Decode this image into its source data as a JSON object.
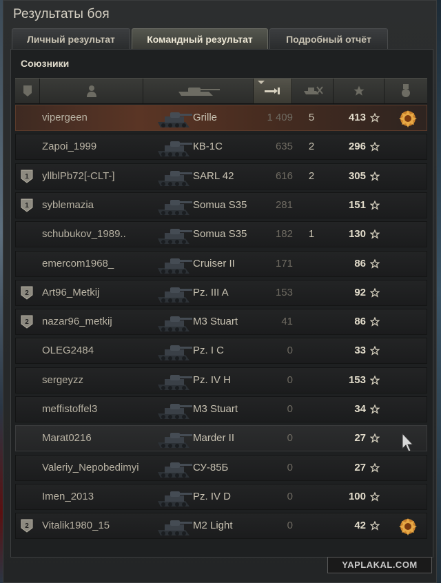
{
  "window": {
    "title": "Результаты боя"
  },
  "tabs": [
    {
      "label": "Личный результат",
      "active": false
    },
    {
      "label": "Командный результат",
      "active": true
    },
    {
      "label": "Подробный отчёт",
      "active": false
    }
  ],
  "section": {
    "title": "Союзники"
  },
  "columns": [
    {
      "icon": "platoon-icon"
    },
    {
      "icon": "player-icon"
    },
    {
      "icon": "tank-icon"
    },
    {
      "icon": "damage-icon",
      "sorted": true
    },
    {
      "icon": "kills-icon"
    },
    {
      "icon": "xp-star-icon"
    },
    {
      "icon": "medal-icon"
    }
  ],
  "rows": [
    {
      "name": "vipergeen",
      "tank": "Grille",
      "damage": "1 409",
      "kills": "5",
      "xp": "413",
      "platoon": "",
      "medal": true,
      "highlight": "me"
    },
    {
      "name": "Zapoi_1999",
      "tank": "КВ-1С",
      "damage": "635",
      "kills": "2",
      "xp": "296",
      "platoon": "",
      "medal": false
    },
    {
      "name": "yllblPb72[-CLT-]",
      "tank": "SARL 42",
      "damage": "616",
      "kills": "2",
      "xp": "305",
      "platoon": "1",
      "medal": false
    },
    {
      "name": "syblemazia",
      "tank": "Somua S35",
      "damage": "281",
      "kills": "",
      "xp": "151",
      "platoon": "1",
      "medal": false
    },
    {
      "name": "schubukov_1989..",
      "tank": "Somua S35",
      "damage": "182",
      "kills": "1",
      "xp": "130",
      "platoon": "",
      "medal": false
    },
    {
      "name": "emercom1968_",
      "tank": "Cruiser II",
      "damage": "171",
      "kills": "",
      "xp": "86",
      "platoon": "",
      "medal": false
    },
    {
      "name": "Art96_Metkij",
      "tank": "Pz. III A",
      "damage": "153",
      "kills": "",
      "xp": "92",
      "platoon": "2",
      "medal": false
    },
    {
      "name": "nazar96_metkij",
      "tank": "M3 Stuart",
      "damage": "41",
      "kills": "",
      "xp": "86",
      "platoon": "2",
      "medal": false
    },
    {
      "name": "OLEG2484",
      "tank": "Pz. I C",
      "damage": "0",
      "kills": "",
      "xp": "33",
      "platoon": "",
      "medal": false
    },
    {
      "name": "sergeyzz",
      "tank": "Pz. IV H",
      "damage": "0",
      "kills": "",
      "xp": "153",
      "platoon": "",
      "medal": false
    },
    {
      "name": "meffistoffel3",
      "tank": "M3 Stuart",
      "damage": "0",
      "kills": "",
      "xp": "34",
      "platoon": "",
      "medal": false
    },
    {
      "name": "Marat0216",
      "tank": "Marder II",
      "damage": "0",
      "kills": "",
      "xp": "27",
      "platoon": "",
      "medal": false,
      "highlight": "hover"
    },
    {
      "name": "Valeriy_Nepobedimyi",
      "tank": "СУ-85Б",
      "damage": "0",
      "kills": "",
      "xp": "27",
      "platoon": "",
      "medal": false
    },
    {
      "name": "Imen_2013",
      "tank": "Pz. IV D",
      "damage": "0",
      "kills": "",
      "xp": "100",
      "platoon": "",
      "medal": false
    },
    {
      "name": "Vitalik1980_15",
      "tank": "M2 Light",
      "damage": "0",
      "kills": "",
      "xp": "42",
      "platoon": "2",
      "medal": true
    }
  ],
  "watermark": "YAPLAKAL.COM",
  "colors": {
    "highlight": "#5a3525",
    "xp": "#e2dccb",
    "damage": "#6f6b62"
  }
}
